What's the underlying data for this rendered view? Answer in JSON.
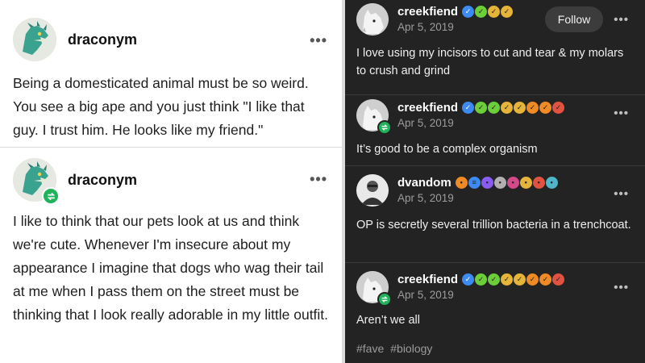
{
  "left": {
    "posts": [
      {
        "username": "draconym",
        "text": "Being a domesticated animal must be so weird. You see a big ape and you just think \"I like that guy. I trust him. He looks like my friend.\""
      },
      {
        "username": "draconym",
        "text": "I like to think that our pets look at us and think we're cute. Whenever I'm insecure about my appearance I imagine that dogs who wag their tail at me when I pass them on the street must be thinking that I look really adorable in my little outfit."
      }
    ],
    "more_label": "•••"
  },
  "right": {
    "follow_label": "Follow",
    "more_label": "•••",
    "posts": [
      {
        "username": "creekfiend",
        "date": "Apr 5, 2019",
        "text": "I love using my incisors to cut and tear & my molars to crush and grind"
      },
      {
        "username": "creekfiend",
        "date": "Apr 5, 2019",
        "text": "It’s good to be a complex organism"
      },
      {
        "username": "dvandom",
        "date": "Apr 5, 2019",
        "text": "OP is secretly several trillion bacteria in a trenchcoat."
      },
      {
        "username": "creekfiend",
        "date": "Apr 5, 2019",
        "text": "Aren’t we all"
      }
    ],
    "tags": [
      "#fave",
      "#biology"
    ]
  },
  "badge_colors": {
    "verified": "#3d8bf2",
    "green": "#6ccf3a",
    "gold": "#e7b43a",
    "orange": "#f08a24",
    "red": "#e25241"
  },
  "accent_reblog": "#21b35a",
  "icons": [
    "dragon-avatar-icon",
    "dog-avatar-icon",
    "reblog-icon",
    "verified-badge-icon",
    "more-icon"
  ]
}
